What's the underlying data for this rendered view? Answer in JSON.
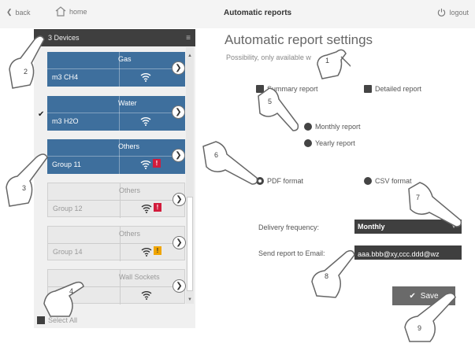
{
  "topbar": {
    "back_label": "back",
    "home_label": "home",
    "title": "Automatic reports",
    "logout_label": "logout"
  },
  "devices_panel": {
    "header": "3 Devices",
    "cards": [
      {
        "category": "Gas",
        "unit": "m3 CH4",
        "style": "blue",
        "checked": false
      },
      {
        "category": "Water",
        "unit": "m3 H2O",
        "style": "blue",
        "checked": true
      },
      {
        "category": "Others",
        "unit": "Group 11",
        "style": "blue",
        "checked": true,
        "badge": "!"
      },
      {
        "category": "Others",
        "unit": "Group 12",
        "style": "grey",
        "checked": false,
        "badge": "!"
      },
      {
        "category": "Others",
        "unit": "Group 14",
        "style": "grey",
        "checked": false,
        "badge": "!"
      },
      {
        "category": "Wall Sockets",
        "unit": "",
        "style": "grey",
        "checked": false
      }
    ],
    "select_all_label": "Select All"
  },
  "settings": {
    "title": "Automatic report settings",
    "subtitle": "Possibility, only available w",
    "summary_report_label": "Summary report",
    "detailed_report_label": "Detailed report",
    "monthly_report_label": "Monthly report",
    "yearly_report_label": "Yearly report",
    "pdf_format_label": "PDF format",
    "csv_format_label": "CSV format",
    "delivery_frequency_label": "Delivery frequency:",
    "delivery_frequency_value": "Monthly",
    "email_label": "Send report to Email:",
    "email_value": "aaa.bbb@xy,ccc.ddd@wz",
    "save_label": "Save"
  },
  "callouts": [
    "1",
    "2",
    "3",
    "4",
    "5",
    "6",
    "7",
    "8",
    "9"
  ],
  "colors": {
    "card_blue": "#3e6f9d",
    "panel_header": "#3f3f3f",
    "badge_red": "#d21c3c",
    "badge_orange": "#f0a500"
  }
}
